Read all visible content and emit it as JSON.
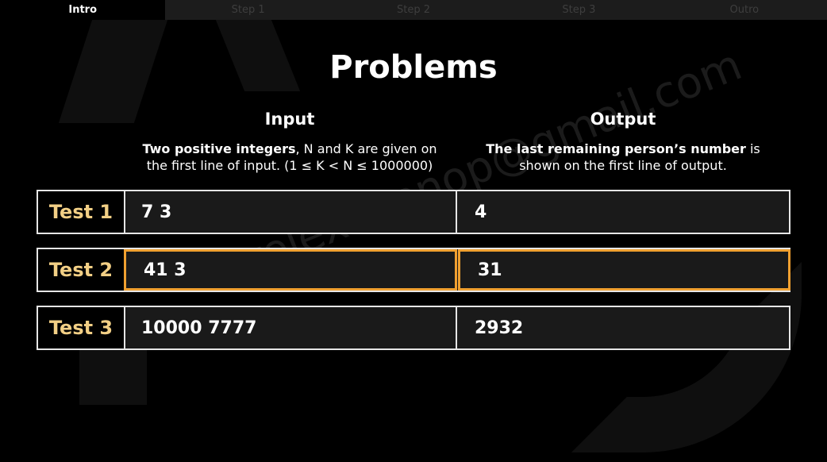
{
  "tabs": [
    {
      "label": "Intro",
      "active": true
    },
    {
      "label": "Step 1",
      "active": false
    },
    {
      "label": "Step 2",
      "active": false
    },
    {
      "label": "Step 3",
      "active": false
    },
    {
      "label": "Outro",
      "active": false
    }
  ],
  "title": "Problems",
  "input": {
    "heading": "Input",
    "desc_bold": "Two positive integers",
    "desc_rest": ", N and K are given on",
    "desc_line2": "the first line of input. (1 ≤ K < N ≤ 1000000)"
  },
  "output": {
    "heading": "Output",
    "desc_bold": "The last remaining person’s number",
    "desc_rest": " is",
    "desc_line2": "shown on the first line of output."
  },
  "tests": [
    {
      "label": "Test 1",
      "input": "7 3",
      "output": "4"
    },
    {
      "label": "Test 2",
      "input": "41 3",
      "output": "31"
    },
    {
      "label": "Test 3",
      "input": "10000 7777",
      "output": "2932"
    }
  ],
  "watermark": "relexsunnop@gmail.com",
  "colors": {
    "accent": "#f2cf85",
    "highlight": "#f0a030",
    "background": "#000000"
  }
}
